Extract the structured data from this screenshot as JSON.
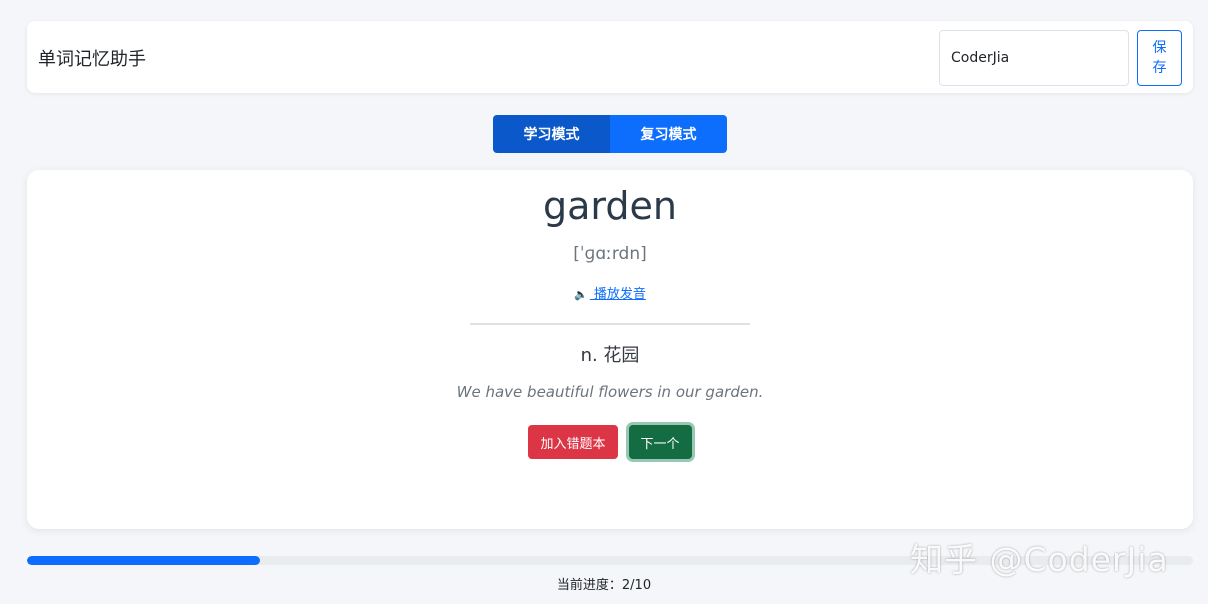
{
  "header": {
    "title": "单词记忆助手",
    "username_value": "CoderJia",
    "save_label": "保存"
  },
  "modes": {
    "study_label": "学习模式",
    "review_label": "复习模式",
    "active": "study"
  },
  "card": {
    "word": "garden",
    "phonetic": "[ˈɡɑːrdn]",
    "play_label": " 播放发音",
    "meaning": "n. 花园",
    "example": "We have beautiful flowers in our garden.",
    "add_mistake_label": "加入错题本",
    "next_label": "下一个"
  },
  "progress": {
    "current": 2,
    "total": 10,
    "text": "当前进度：2/10"
  },
  "watermark": "知乎 @CoderJia",
  "colors": {
    "primary": "#0d6efd",
    "danger": "#dc3545",
    "success": "#146c43"
  },
  "icons": {
    "play": "speaker-icon"
  }
}
